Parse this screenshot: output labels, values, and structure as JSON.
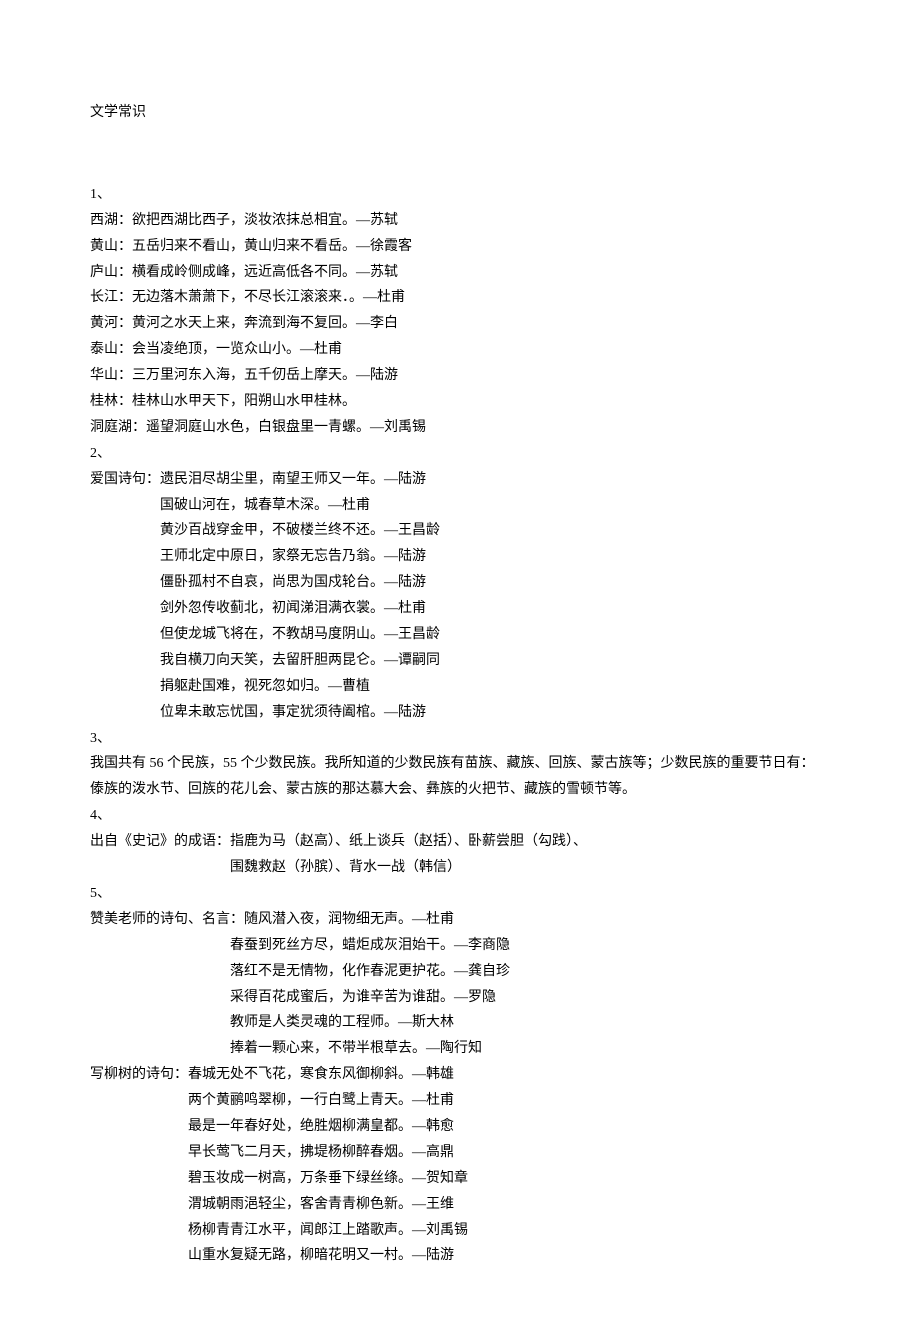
{
  "title": "文学常识",
  "sections": {
    "s1": {
      "num": "1、",
      "lines": [
        "西湖：欲把西湖比西子，淡妆浓抹总相宜。—苏轼",
        "黄山：五岳归来不看山，黄山归来不看岳。—徐霞客",
        "庐山：横看成岭侧成峰，远近高低各不同。—苏轼",
        "长江：无边落木萧萧下，不尽长江滚滚来．。—杜甫",
        "黄河：黄河之水天上来，奔流到海不复回。—李白",
        "泰山：会当凌绝顶，一览众山小。—杜甫",
        "华山：三万里河东入海，五千仞岳上摩天。—陆游",
        "桂林：桂林山水甲天下，阳朔山水甲桂林。",
        "洞庭湖：遥望洞庭山水色，白银盘里一青螺。—刘禹锡"
      ]
    },
    "s2": {
      "num": "2、",
      "lead": "爱国诗句：遗民泪尽胡尘里，南望王师又一年。—陆游",
      "lines": [
        "国破山河在，城春草木深。—杜甫",
        "黄沙百战穿金甲，不破楼兰终不还。—王昌龄",
        "王师北定中原日，家祭无忘告乃翁。—陆游",
        "僵卧孤村不自哀，尚思为国戍轮台。—陆游",
        "剑外忽传收蓟北，初闻涕泪满衣裳。—杜甫",
        "但使龙城飞将在，不教胡马度阴山。—王昌龄",
        "我自横刀向天笑，去留肝胆两昆仑。—谭嗣同",
        "捐躯赴国难，视死忽如归。—曹植",
        "位卑未敢忘忧国，事定犹须待阖棺。—陆游"
      ]
    },
    "s3": {
      "num": "3、",
      "lines": [
        "我国共有 56 个民族，55 个少数民族。我所知道的少数民族有苗族、藏族、回族、蒙古族等；少数民族的重要节日有：",
        "傣族的泼水节、回族的花儿会、蒙古族的那达慕大会、彝族的火把节、藏族的雪顿节等。"
      ]
    },
    "s4": {
      "num": "4、",
      "lead": "出自《史记》的成语：指鹿为马（赵高）、纸上谈兵（赵括）、卧薪尝胆（勾践）、",
      "lines": [
        "围魏救赵（孙膑）、背水一战（韩信）"
      ]
    },
    "s5": {
      "num": "5、",
      "teacher_lead": "赞美老师的诗句、名言：随风潜入夜，润物细无声。—杜甫",
      "teacher_lines": [
        "春蚕到死丝方尽，蜡炬成灰泪始干。—李商隐",
        "落红不是无情物，化作春泥更护花。—龚自珍",
        "采得百花成蜜后，为谁辛苦为谁甜。—罗隐",
        "教师是人类灵魂的工程师。—斯大林",
        "捧着一颗心来，不带半根草去。—陶行知"
      ],
      "willow_lead": "写柳树的诗句：春城无处不飞花，寒食东风御柳斜。—韩雄",
      "willow_lines": [
        "两个黄鹂鸣翠柳，一行白鹭上青天。—杜甫",
        "最是一年春好处，绝胜烟柳满皇都。—韩愈",
        "早长莺飞二月天，拂堤杨柳醉春烟。—高鼎",
        "碧玉妆成一树高，万条垂下绿丝绦。—贺知章",
        "渭城朝雨浥轻尘，客舍青青柳色新。—王维",
        "杨柳青青江水平，闻郎江上踏歌声。—刘禹锡",
        "山重水复疑无路，柳暗花明又一村。—陆游"
      ]
    }
  }
}
